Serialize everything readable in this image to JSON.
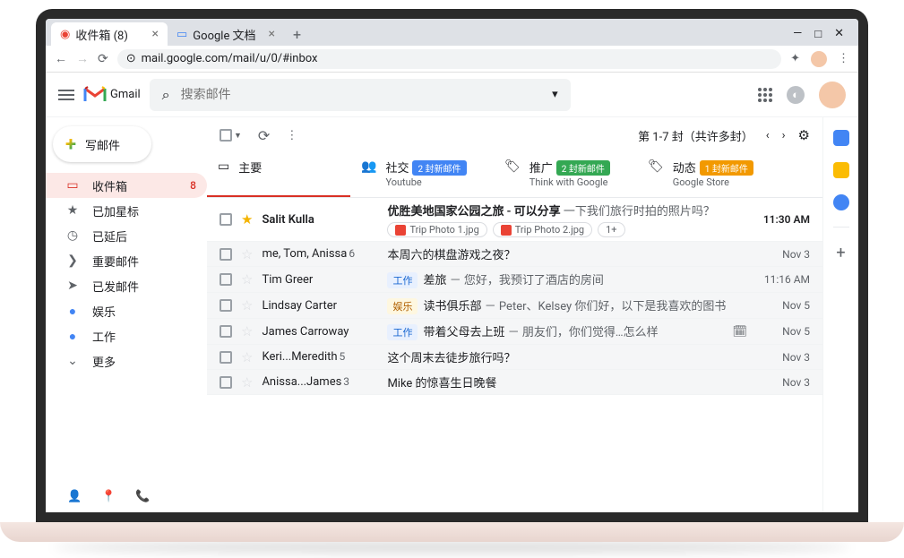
{
  "browser": {
    "tabs": [
      {
        "favicon": "gmail",
        "title": "收件箱 (8)"
      },
      {
        "favicon": "docs",
        "title": "Google 文档"
      }
    ],
    "url_prefix": "mail.google.com",
    "url_rest": "/mail/u/0/#inbox"
  },
  "header": {
    "product": "Gmail",
    "search_placeholder": "搜索邮件"
  },
  "compose_label": "写邮件",
  "sidebar": {
    "items": [
      {
        "icon": "inbox",
        "label": "收件箱",
        "count": "8",
        "active": true
      },
      {
        "icon": "star",
        "label": "已加星标"
      },
      {
        "icon": "clock",
        "label": "已延后"
      },
      {
        "icon": "important",
        "label": "重要邮件"
      },
      {
        "icon": "sent",
        "label": "已发邮件"
      },
      {
        "icon": "label-blue",
        "label": "娱乐"
      },
      {
        "icon": "label-blue",
        "label": "工作"
      },
      {
        "icon": "more",
        "label": "更多"
      }
    ]
  },
  "toolbar": {
    "page_info": "第 1-7 封（共许多封）"
  },
  "category_tabs": [
    {
      "icon": "inbox",
      "label": "主要",
      "active": true
    },
    {
      "icon": "social",
      "label": "社交",
      "badge": "2 封新邮件",
      "badge_class": "b-blue",
      "sub": "Youtube"
    },
    {
      "icon": "promo",
      "label": "推广",
      "badge": "2 封新邮件",
      "badge_class": "b-green",
      "sub": "Think with Google"
    },
    {
      "icon": "updates",
      "label": "动态",
      "badge": "1 封新邮件",
      "badge_class": "b-orange",
      "sub": "Google Store"
    }
  ],
  "rows": [
    {
      "unread": true,
      "starred": true,
      "sender": "Salit Kulla",
      "subject": "优胜美地国家公园之旅 - 可以分享",
      "snippet": "一下我们旅行时拍的照片吗？",
      "date": "11:30 AM",
      "attachments": [
        "Trip Photo 1.jpg",
        "Trip Photo 2.jpg"
      ],
      "att_more": "1+"
    },
    {
      "unread": false,
      "sender": "me, Tom, Anissa",
      "sender_count": "6",
      "subject": "本周六的棋盘游戏之夜？",
      "date": "Nov 3"
    },
    {
      "unread": false,
      "sender": "Tim Greer",
      "chip": "工作",
      "chip_class": "c-blue",
      "subject": "差旅",
      "snippet": "－ 您好，我预订了酒店的房间",
      "date": "11:16 AM"
    },
    {
      "unread": false,
      "sender": "Lindsay Carter",
      "chip": "娱乐",
      "chip_class": "c-orange",
      "subject": "读书俱乐部",
      "snippet": "－ Peter、Kelsey 你们好，以下是我喜欢的图书",
      "date": "Nov 5"
    },
    {
      "unread": false,
      "sender": "James Carroway",
      "chip": "工作",
      "chip_class": "c-blue",
      "subject": "带着父母去上班",
      "snippet": "－ 朋友们，你们觉得…怎么样",
      "date": "Nov 5",
      "has_event": true
    },
    {
      "unread": false,
      "sender": "Keri...Meredith",
      "sender_count": "5",
      "subject": "这个周末去徒步旅行吗？",
      "date": "Nov 3"
    },
    {
      "unread": false,
      "sender": "Anissa...James",
      "sender_count": "3",
      "subject": "Mike 的惊喜生日晚餐",
      "date": "Nov 3"
    }
  ]
}
